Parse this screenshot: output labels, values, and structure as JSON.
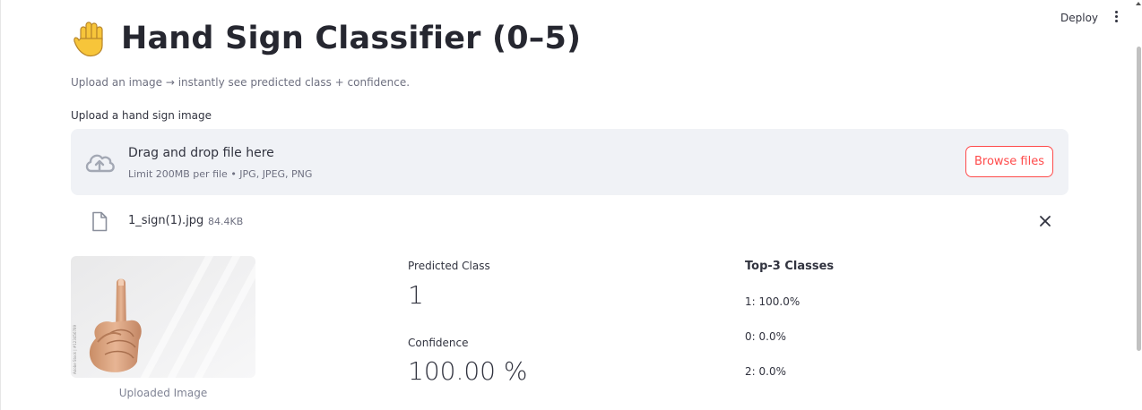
{
  "header": {
    "deploy_label": "Deploy",
    "menu_icon": "kebab-menu-icon"
  },
  "title": {
    "emoji_icon": "raised-hand-icon",
    "text": "Hand Sign Classifier (0–5)"
  },
  "subtitle": "Upload an image → instantly see predicted class + confidence.",
  "uploader": {
    "label": "Upload a hand sign image",
    "drop_title": "Drag and drop file here",
    "drop_limit": "Limit 200MB per file • JPG, JPEG, PNG",
    "browse_label": "Browse files",
    "icon": "cloud-upload-icon"
  },
  "file": {
    "name": "1_sign(1).jpg",
    "size": "84.4KB",
    "icon": "file-icon"
  },
  "image": {
    "caption": "Uploaded Image",
    "watermark": "Adobe Stock | #123456789"
  },
  "prediction": {
    "class_label": "Predicted Class",
    "class_value": "1",
    "confidence_label": "Confidence",
    "confidence_value": "100.00 %"
  },
  "top3": {
    "header": "Top-3 Classes",
    "items": [
      "1: 100.0%",
      "0: 0.0%",
      "2: 0.0%"
    ]
  },
  "colors": {
    "accent": "#ff4b4b",
    "dropzone_bg": "#f0f2f6",
    "text": "#31333f"
  }
}
